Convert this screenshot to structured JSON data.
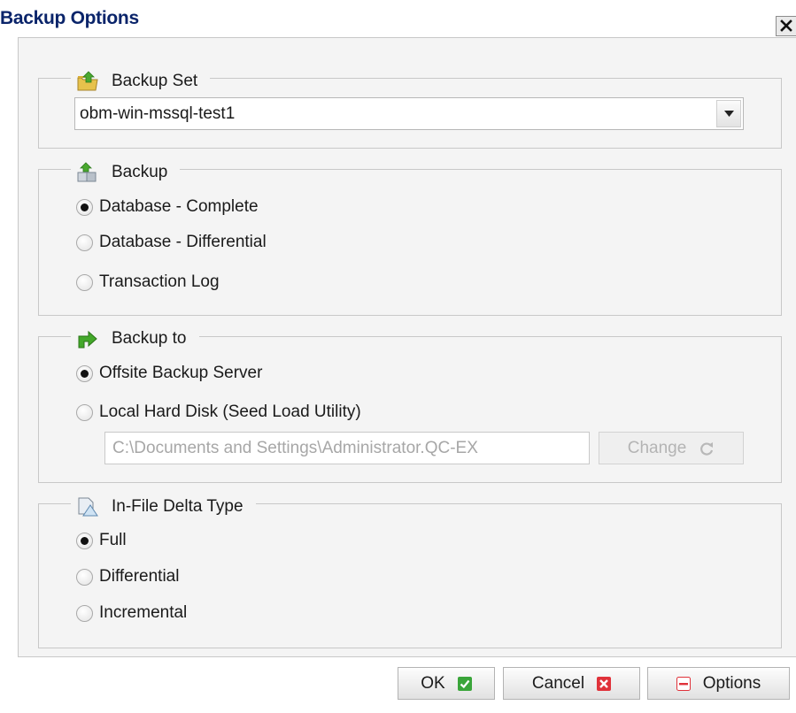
{
  "window": {
    "title": "Backup Options",
    "close_glyph": "✕"
  },
  "backup_set": {
    "title": "Backup Set",
    "icon": "folder-upload-icon",
    "selected": "obm-win-mssql-test1"
  },
  "backup": {
    "title": "Backup",
    "icon": "backup-boxes-icon",
    "options": [
      {
        "label": "Database - Complete",
        "checked": true
      },
      {
        "label": "Database - Differential",
        "checked": false
      },
      {
        "label": "Transaction Log",
        "checked": false
      }
    ]
  },
  "backup_to": {
    "title": "Backup to",
    "icon": "green-arrow-icon",
    "options": [
      {
        "label": "Offsite Backup Server",
        "checked": true
      },
      {
        "label": "Local Hard Disk (Seed Load Utility)",
        "checked": false
      }
    ],
    "path_value": "C:\\Documents and Settings\\Administrator.QC-EX",
    "change_label": "Change"
  },
  "delta": {
    "title": "In-File Delta Type",
    "icon": "delta-file-icon",
    "options": [
      {
        "label": "Full",
        "checked": true
      },
      {
        "label": "Differential",
        "checked": false
      },
      {
        "label": "Incremental",
        "checked": false
      }
    ]
  },
  "buttons": {
    "ok": "OK",
    "cancel": "Cancel",
    "options": "Options"
  },
  "colors": {
    "title_text": "#0a246a",
    "panel_bg": "#f4f4f4",
    "ok_green": "#3aa53a",
    "cancel_red": "#e0323a"
  }
}
